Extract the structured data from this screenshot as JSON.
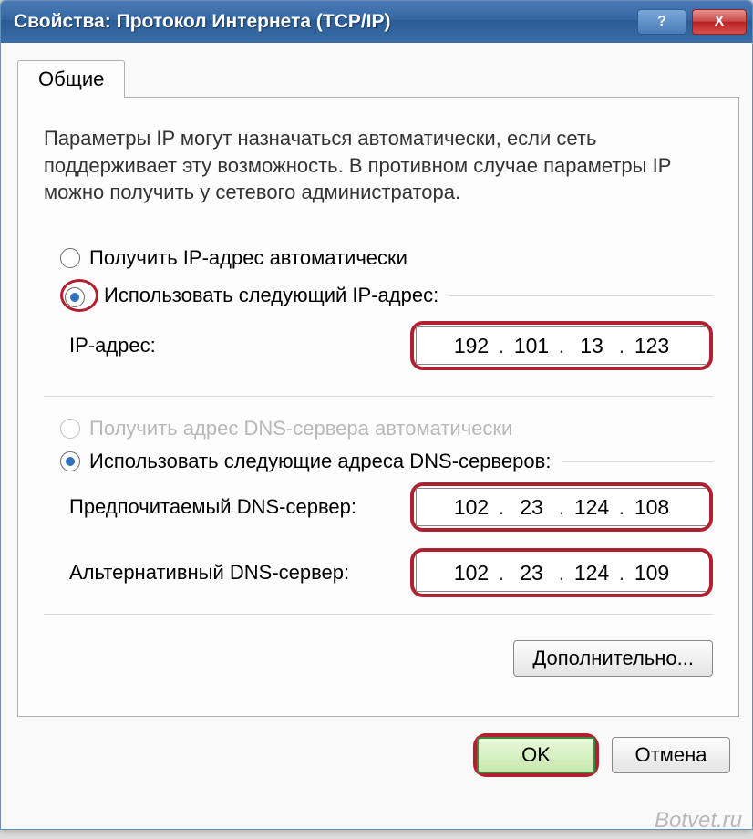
{
  "titlebar": {
    "title": "Свойства: Протокол Интернета (TCP/IP)",
    "help": "?",
    "close": "X"
  },
  "tabs": {
    "general": "Общие"
  },
  "description": "Параметры IP могут назначаться автоматически, если сеть поддерживает эту возможность. В противном случае параметры IP можно получить у сетевого администратора.",
  "ip_section": {
    "auto_label": "Получить IP-адрес автоматически",
    "manual_label": "Использовать следующий IP-адрес:",
    "ip_label": "IP-адрес:",
    "ip_value": {
      "o1": "192",
      "o2": "101",
      "o3": "13",
      "o4": "123"
    }
  },
  "dns_section": {
    "auto_label": "Получить адрес DNS-сервера автоматически",
    "manual_label": "Использовать следующие адреса DNS-серверов:",
    "pref_label": "Предпочитаемый DNS-сервер:",
    "pref_value": {
      "o1": "102",
      "o2": "23",
      "o3": "124",
      "o4": "108"
    },
    "alt_label": "Альтернативный DNS-сервер:",
    "alt_value": {
      "o1": "102",
      "o2": "23",
      "o3": "124",
      "o4": "109"
    }
  },
  "buttons": {
    "advanced": "Дополнительно...",
    "ok": "OK",
    "cancel": "Отмена"
  },
  "watermark": "Botvet.ru"
}
